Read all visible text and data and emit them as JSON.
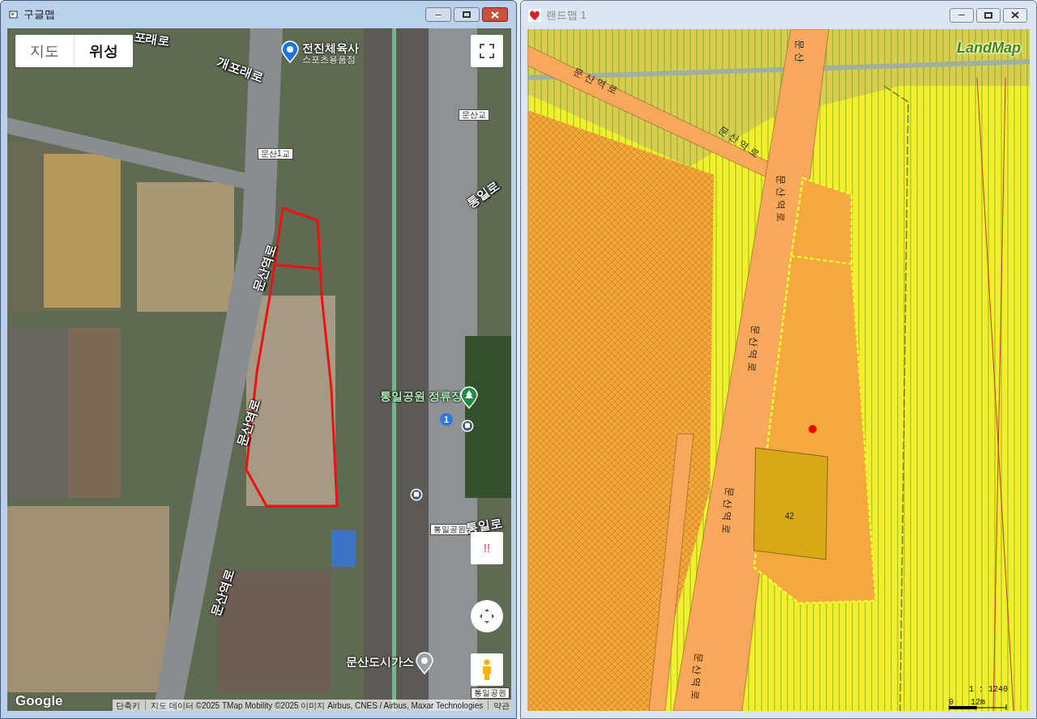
{
  "google_window": {
    "title": "구글맵",
    "active": true,
    "map_type_buttons": [
      {
        "label": "지도",
        "selected": false
      },
      {
        "label": "위성",
        "selected": true
      }
    ],
    "labels": [
      {
        "kind": "road",
        "text": "포래로"
      },
      {
        "kind": "road",
        "text": "개포래로"
      },
      {
        "kind": "place",
        "text": "문산교"
      },
      {
        "kind": "place",
        "text": "문산1교"
      },
      {
        "kind": "road",
        "text": "통일로"
      },
      {
        "kind": "road",
        "text": "문산역로"
      },
      {
        "kind": "road",
        "text": "문산역로"
      },
      {
        "kind": "road",
        "text": "문산역로"
      },
      {
        "kind": "place",
        "text": "통일공원"
      },
      {
        "kind": "road",
        "text": "통일로"
      },
      {
        "kind": "place",
        "text": "통일공원"
      }
    ],
    "pois": [
      {
        "kind": "shop",
        "name": "전진체육사",
        "sub": "스포츠용품점"
      },
      {
        "kind": "park",
        "name": "통일공원 정류장"
      },
      {
        "kind": "place",
        "name": "문산도시가스"
      }
    ],
    "route_badge": "1",
    "alert_button": "!!",
    "logo": "Google",
    "attribution": [
      "단축키",
      "지도 데이터 ©2025 TMap Mobility ©2025 이미지 Airbus, CNES / Airbus, Maxar Technologies",
      "약관"
    ]
  },
  "landmap_window": {
    "title": "랜드맵 1",
    "active": false,
    "logo": "LandMap",
    "labels": [
      "문 산",
      "문 산 역 로",
      "문 산 역 로",
      "문 산 역 로",
      "문 산 역 로",
      "문 산 역 로",
      "문 산 역 로"
    ],
    "parcel_number": "42",
    "scale": {
      "ratio": "1 : 1240",
      "zero": "0",
      "distance": "12m"
    }
  }
}
